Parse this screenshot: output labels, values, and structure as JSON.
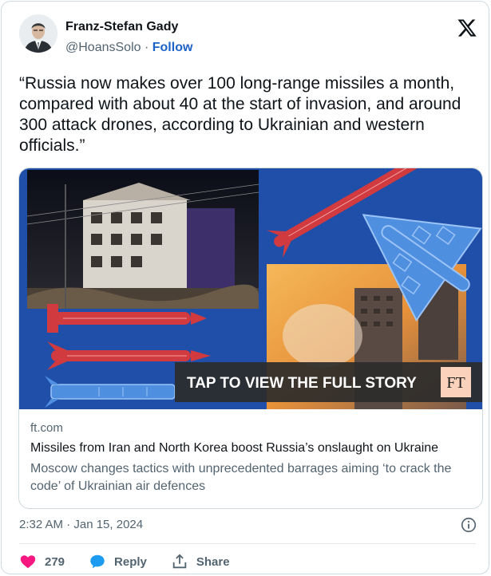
{
  "author": {
    "name": "Franz-Stefan Gady",
    "handle": "@HoansSolo",
    "separator": "·",
    "follow_label": "Follow"
  },
  "tweet": {
    "text": "“Russia now makes over 100 long-range missiles a month, compared with about 40 at the start of invasion, and around 300 attack drones, according to Ukrainian and western officials.”"
  },
  "card": {
    "overlay_text": "TAP TO VIEW THE FULL STORY",
    "publisher_badge": "FT",
    "domain": "ft.com",
    "title": "Missiles from Iran and North Korea boost Russia’s onslaught on Ukraine",
    "description": "Moscow changes tactics with unprecedented barrages aiming ‘to crack the code’ of Ukrainian air defences"
  },
  "meta": {
    "timestamp": "2:32 AM · Jan 15, 2024"
  },
  "actions": {
    "like_count": "279",
    "reply_label": "Reply",
    "share_label": "Share"
  },
  "colors": {
    "like": "#f91880",
    "reply": "#1d9bf0",
    "follow": "#1d62c9",
    "card_bg": "#1f4fa8",
    "ft_badge": "#fbd3bd"
  }
}
